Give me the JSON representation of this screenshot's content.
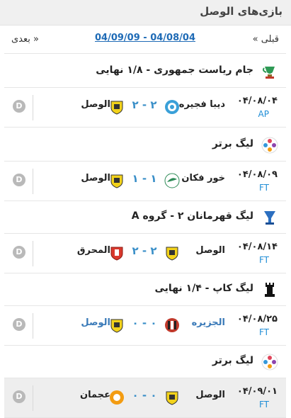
{
  "header": {
    "title": "بازی‌های الوصل"
  },
  "nav": {
    "prev": "« قبلی",
    "range": "04/09/09 - 04/08/04",
    "next": "بعدی »"
  },
  "sections": [
    {
      "competition": "جام ریاست جمهوری - ۱/۸ نهایی",
      "icon": "trophy-green-icon",
      "match": {
        "date": "۰۴/۰۸/۰۴",
        "status": "AP",
        "home": "دیبا فجیره",
        "home_logo": "dibba-logo",
        "score": "۲ - ۲",
        "away": "الوصل",
        "away_logo": "alwasl-logo",
        "details": "D"
      }
    },
    {
      "competition": "لیگ برتر",
      "icon": "league-badge-icon",
      "match": {
        "date": "۰۴/۰۸/۰۹",
        "status": "FT",
        "home": "خور فکان",
        "home_logo": "khorfakkan-logo",
        "score": "۱ - ۱",
        "away": "الوصل",
        "away_logo": "alwasl-logo",
        "details": "D"
      }
    },
    {
      "competition": "لیگ قهرمانان ۲ - گروه A",
      "icon": "champions-trophy-icon",
      "match": {
        "date": "۰۴/۰۸/۱۴",
        "status": "FT",
        "home": "الوصل",
        "home_logo": "alwasl-logo",
        "score": "۲ - ۲",
        "away": "المحرق",
        "away_logo": "muharraq-logo",
        "details": "D"
      }
    },
    {
      "competition": "لیگ کاپ - ۱/۴ نهایی",
      "icon": "rook-trophy-icon",
      "match": {
        "date": "۰۴/۰۸/۲۵",
        "status": "FT",
        "home": "الجزیره",
        "home_logo": "aljazira-logo",
        "score": "۰ - ۰",
        "away": "الوصل",
        "away_logo": "alwasl-logo",
        "details": "D"
      }
    },
    {
      "competition": "لیگ برتر",
      "icon": "league-badge-icon",
      "match": {
        "date": "۰۴/۰۹/۰۱",
        "status": "FT",
        "home": "الوصل",
        "home_logo": "alwasl-logo",
        "score": "۰ - ۰",
        "away": "عجمان",
        "away_logo": "ajman-logo",
        "details": "D"
      }
    }
  ],
  "colors": {
    "accent": "#1f8dd6",
    "score": "#3a8fc8",
    "link": "#1f6bb6",
    "header_bg": "#f0f0f0",
    "highlight_row": "#eeeeee"
  }
}
